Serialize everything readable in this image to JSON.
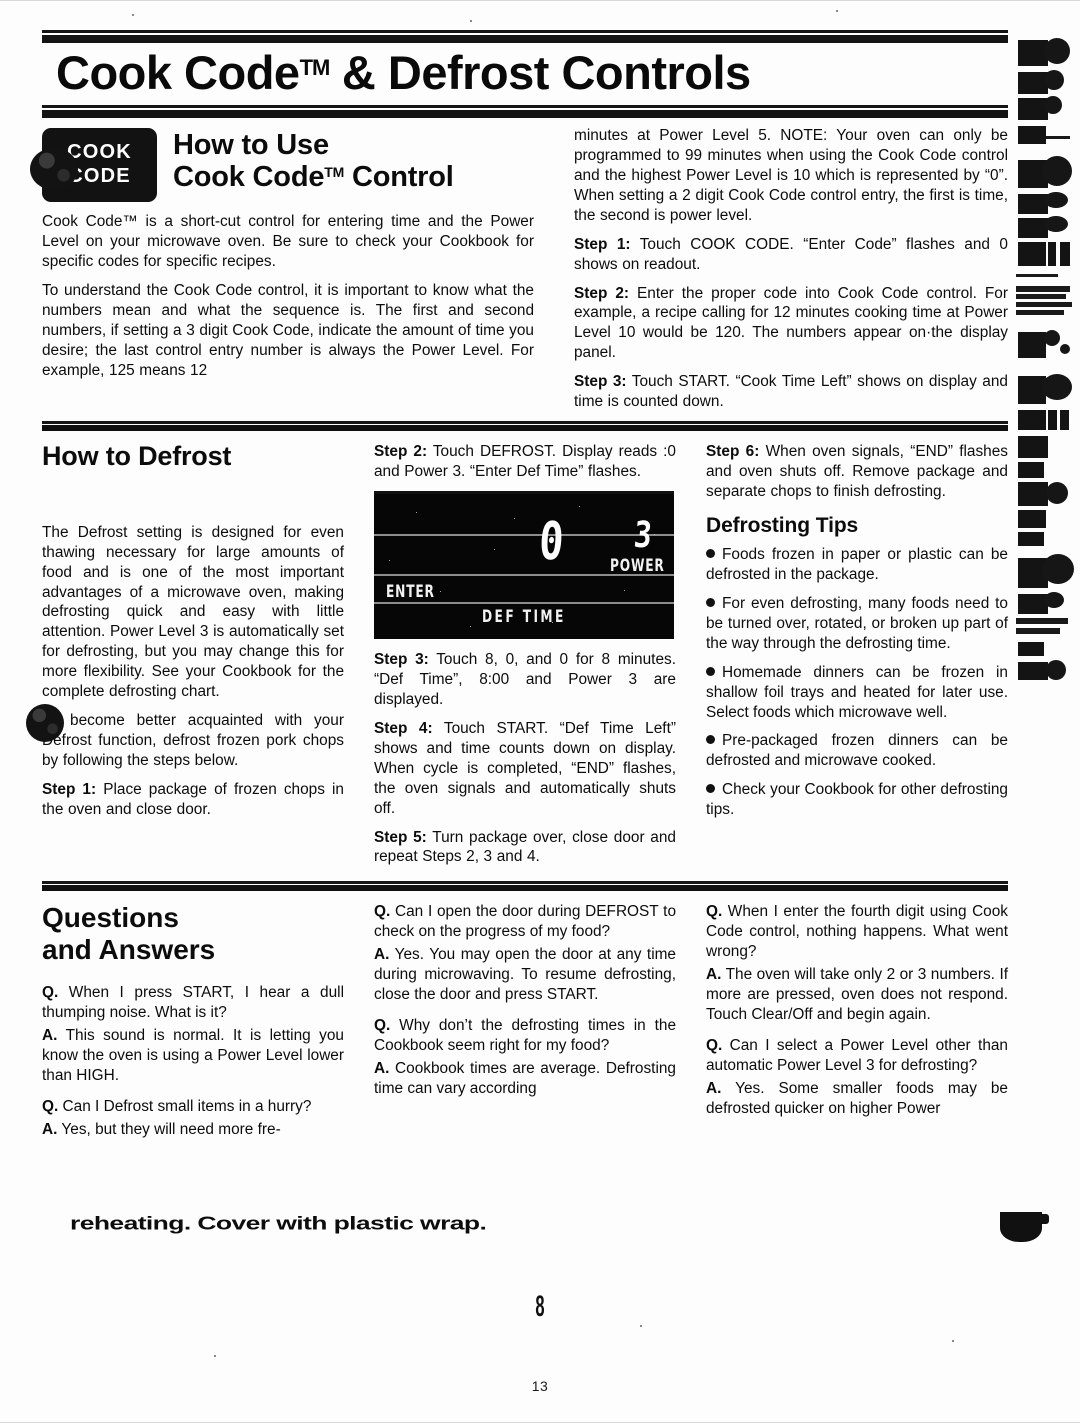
{
  "masthead": {
    "title_main": "Cook Code",
    "title_tm": "TM",
    "title_rest": " & Defrost Controls"
  },
  "how_to_use": {
    "badge_line1": "COOK",
    "badge_line2": "CODE",
    "heading_line1": "How to Use",
    "heading_line2_main": "Cook Code",
    "heading_line2_tm": "TM",
    "heading_line2_rest": " Control",
    "paragraphs": [
      "Cook Code™ is a short-cut control for entering time and the Power Level on your microwave oven. Be sure to check your Cookbook for specific codes for specific recipes.",
      "To understand the Cook Code control, it is important to know what the numbers mean and what the sequence is. The first and second numbers, if setting a 3 digit Cook Code, indicate the amount of time you desire; the last control entry number is always the Power Level. For example, 125 means 12",
      "minutes at Power Level 5. NOTE: Your oven can only be programmed to 99 minutes when using the Cook Code control and the highest Power Level is 10 which is represented by “0”. When setting a 2 digit Cook Code control entry, the first is time, the second is power level."
    ],
    "steps": [
      {
        "label": "Step 1:",
        "text": " Touch COOK CODE. “Enter Code” flashes and 0 shows on readout."
      },
      {
        "label": "Step 2:",
        "text": " Enter the proper code into Cook Code control. For example, a recipe calling for 12 minutes cooking time at Power Level 10 would be 120. The numbers appear on·the display panel."
      },
      {
        "label": "Step 3:",
        "text": " Touch START. “Cook Time Left” shows on display and time is counted down."
      }
    ]
  },
  "how_to_defrost": {
    "heading": "How to Defrost",
    "paragraphs": [
      "The Defrost setting is designed for even thawing necessary for large amounts of food and is one of the most important advantages of a microwave oven, making defrosting quick and easy with little attention. Power Level 3 is automatically set for defrosting, but you may change this for more flexibility. See your Cookbook for the complete defrosting chart.",
      "To become better acquainted with your Defrost function, defrost frozen pork chops by following the steps below."
    ],
    "steps": [
      {
        "label": "Step 1:",
        "text": " Place package of frozen chops in the oven and close door."
      },
      {
        "label": "Step 2:",
        "text": " Touch DEFROST. Display reads :0 and Power 3. “Enter Def Time” flashes."
      },
      {
        "label": "Step 3:",
        "text": " Touch 8, 0, and 0 for 8 minutes. “Def Time”, 8:00 and Power 3 are displayed."
      },
      {
        "label": "Step 4:",
        "text": " Touch START. “Def Time Left” shows and time counts down on display. When cycle is completed, “END” flashes, the oven signals and automatically shuts off."
      },
      {
        "label": "Step 5:",
        "text": " Turn package over, close door and repeat Steps 2, 3 and 4."
      },
      {
        "label": "Step 6:",
        "text": " When oven signals, “END” flashes and oven shuts off. Remove package and separate chops to finish defrosting."
      }
    ]
  },
  "display_panel": {
    "digit_time": "0",
    "digit_power": "3",
    "label_power": "POWER",
    "label_enter": "ENTER",
    "label_def_time": "DEF  TIME"
  },
  "defrosting_tips": {
    "heading": "Defrosting Tips",
    "tips": [
      "Foods frozen in paper or plastic can be defrosted in the package.",
      "For even defrosting, many foods need to be turned over, rotated, or broken up part of the way through the defrosting time.",
      "Homemade dinners can be frozen in shallow foil trays and heated for later use. Select foods which microwave well.",
      "Pre-packaged frozen dinners can be defrosted and microwave cooked.",
      "Check your Cookbook for other defrosting tips."
    ]
  },
  "questions_answers": {
    "heading_line1": "Questions",
    "heading_line2": "and Answers",
    "items": [
      {
        "q_tag": "Q.",
        "q": " When I press START, I hear a dull thumping noise. What is it?",
        "a_tag": "A.",
        "a": " This sound is normal. It is letting you know the oven is using a Power Level lower than HIGH."
      },
      {
        "q_tag": "Q.",
        "q": " Can I Defrost small items in a hurry?",
        "a_tag": "A.",
        "a": " Yes, but they will need more fre-"
      },
      {
        "q_tag": "Q.",
        "q": " Can I open the door during DEFROST to check on the progress of my food?",
        "a_tag": "A.",
        "a": " Yes. You may open the door at any time during microwaving. To resume defrosting, close the door and press START."
      },
      {
        "q_tag": "Q.",
        "q": " Why don’t the defrosting times in the Cookbook seem right for my food?",
        "a_tag": "A.",
        "a": " Cookbook times are average. Defrosting time can vary according"
      },
      {
        "q_tag": "Q.",
        "q": " When I enter the fourth digit using Cook Code control, nothing happens. What went wrong?",
        "a_tag": "A.",
        "a": " The oven will take only 2 or 3 numbers. If more are pressed, oven does not respond. Touch Clear/Off and begin again."
      },
      {
        "q_tag": "Q.",
        "q": " Can I select a Power Level other than automatic Power Level 3 for defrosting?",
        "a_tag": "A.",
        "a": " Yes. Some smaller foods may be defrosted quicker on higher Power"
      }
    ],
    "scan_artifact_line": "reheating. Cover with plastic wrap."
  },
  "footer": {
    "folio_big": "8",
    "folio_small": "13"
  }
}
